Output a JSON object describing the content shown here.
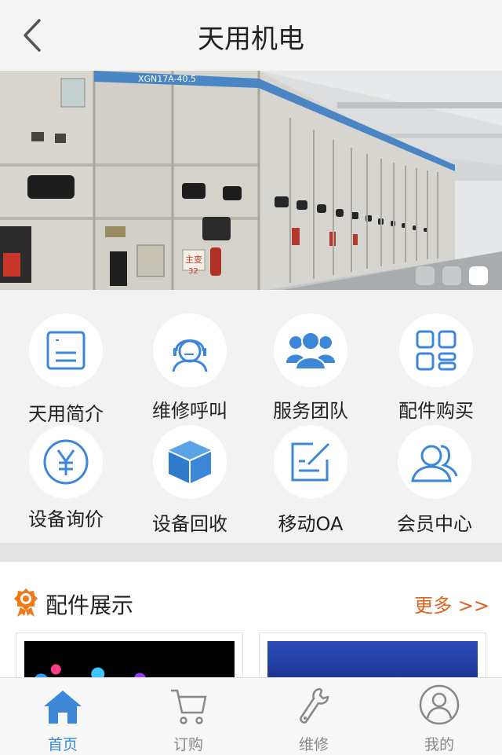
{
  "header": {
    "title": "天用机电"
  },
  "banner": {
    "panel_code": "XGN17A-40.5",
    "tag_text": "主变",
    "tag_number": "32",
    "slides": 3,
    "active_slide": 3
  },
  "menu": [
    {
      "label": "天用简介",
      "icon": "document-icon"
    },
    {
      "label": "维修呼叫",
      "icon": "headset-icon"
    },
    {
      "label": "服务团队",
      "icon": "team-icon"
    },
    {
      "label": "配件购买",
      "icon": "grid-icon"
    },
    {
      "label": "设备询价",
      "icon": "yen-icon"
    },
    {
      "label": "设备回收",
      "icon": "cube-icon"
    },
    {
      "label": "移动OA",
      "icon": "edit-icon"
    },
    {
      "label": "会员中心",
      "icon": "members-icon"
    }
  ],
  "parts": {
    "title": "配件展示",
    "more": "更多 >>"
  },
  "tabs": [
    {
      "label": "首页",
      "icon": "home-icon",
      "active": true
    },
    {
      "label": "订购",
      "icon": "cart-icon"
    },
    {
      "label": "维修",
      "icon": "wrench-icon"
    },
    {
      "label": "我的",
      "icon": "user-icon"
    }
  ],
  "colors": {
    "accent": "#3d87d8",
    "more": "#e0601c",
    "award": "#f07a1a"
  }
}
